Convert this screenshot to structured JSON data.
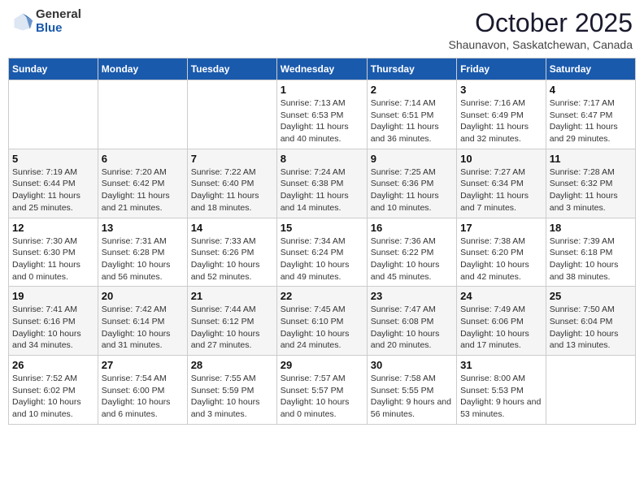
{
  "header": {
    "logo_general": "General",
    "logo_blue": "Blue",
    "month_title": "October 2025",
    "location": "Shaunavon, Saskatchewan, Canada"
  },
  "weekdays": [
    "Sunday",
    "Monday",
    "Tuesday",
    "Wednesday",
    "Thursday",
    "Friday",
    "Saturday"
  ],
  "weeks": [
    [
      {
        "day": "",
        "info": ""
      },
      {
        "day": "",
        "info": ""
      },
      {
        "day": "",
        "info": ""
      },
      {
        "day": "1",
        "info": "Sunrise: 7:13 AM\nSunset: 6:53 PM\nDaylight: 11 hours and 40 minutes."
      },
      {
        "day": "2",
        "info": "Sunrise: 7:14 AM\nSunset: 6:51 PM\nDaylight: 11 hours and 36 minutes."
      },
      {
        "day": "3",
        "info": "Sunrise: 7:16 AM\nSunset: 6:49 PM\nDaylight: 11 hours and 32 minutes."
      },
      {
        "day": "4",
        "info": "Sunrise: 7:17 AM\nSunset: 6:47 PM\nDaylight: 11 hours and 29 minutes."
      }
    ],
    [
      {
        "day": "5",
        "info": "Sunrise: 7:19 AM\nSunset: 6:44 PM\nDaylight: 11 hours and 25 minutes."
      },
      {
        "day": "6",
        "info": "Sunrise: 7:20 AM\nSunset: 6:42 PM\nDaylight: 11 hours and 21 minutes."
      },
      {
        "day": "7",
        "info": "Sunrise: 7:22 AM\nSunset: 6:40 PM\nDaylight: 11 hours and 18 minutes."
      },
      {
        "day": "8",
        "info": "Sunrise: 7:24 AM\nSunset: 6:38 PM\nDaylight: 11 hours and 14 minutes."
      },
      {
        "day": "9",
        "info": "Sunrise: 7:25 AM\nSunset: 6:36 PM\nDaylight: 11 hours and 10 minutes."
      },
      {
        "day": "10",
        "info": "Sunrise: 7:27 AM\nSunset: 6:34 PM\nDaylight: 11 hours and 7 minutes."
      },
      {
        "day": "11",
        "info": "Sunrise: 7:28 AM\nSunset: 6:32 PM\nDaylight: 11 hours and 3 minutes."
      }
    ],
    [
      {
        "day": "12",
        "info": "Sunrise: 7:30 AM\nSunset: 6:30 PM\nDaylight: 11 hours and 0 minutes."
      },
      {
        "day": "13",
        "info": "Sunrise: 7:31 AM\nSunset: 6:28 PM\nDaylight: 10 hours and 56 minutes."
      },
      {
        "day": "14",
        "info": "Sunrise: 7:33 AM\nSunset: 6:26 PM\nDaylight: 10 hours and 52 minutes."
      },
      {
        "day": "15",
        "info": "Sunrise: 7:34 AM\nSunset: 6:24 PM\nDaylight: 10 hours and 49 minutes."
      },
      {
        "day": "16",
        "info": "Sunrise: 7:36 AM\nSunset: 6:22 PM\nDaylight: 10 hours and 45 minutes."
      },
      {
        "day": "17",
        "info": "Sunrise: 7:38 AM\nSunset: 6:20 PM\nDaylight: 10 hours and 42 minutes."
      },
      {
        "day": "18",
        "info": "Sunrise: 7:39 AM\nSunset: 6:18 PM\nDaylight: 10 hours and 38 minutes."
      }
    ],
    [
      {
        "day": "19",
        "info": "Sunrise: 7:41 AM\nSunset: 6:16 PM\nDaylight: 10 hours and 34 minutes."
      },
      {
        "day": "20",
        "info": "Sunrise: 7:42 AM\nSunset: 6:14 PM\nDaylight: 10 hours and 31 minutes."
      },
      {
        "day": "21",
        "info": "Sunrise: 7:44 AM\nSunset: 6:12 PM\nDaylight: 10 hours and 27 minutes."
      },
      {
        "day": "22",
        "info": "Sunrise: 7:45 AM\nSunset: 6:10 PM\nDaylight: 10 hours and 24 minutes."
      },
      {
        "day": "23",
        "info": "Sunrise: 7:47 AM\nSunset: 6:08 PM\nDaylight: 10 hours and 20 minutes."
      },
      {
        "day": "24",
        "info": "Sunrise: 7:49 AM\nSunset: 6:06 PM\nDaylight: 10 hours and 17 minutes."
      },
      {
        "day": "25",
        "info": "Sunrise: 7:50 AM\nSunset: 6:04 PM\nDaylight: 10 hours and 13 minutes."
      }
    ],
    [
      {
        "day": "26",
        "info": "Sunrise: 7:52 AM\nSunset: 6:02 PM\nDaylight: 10 hours and 10 minutes."
      },
      {
        "day": "27",
        "info": "Sunrise: 7:54 AM\nSunset: 6:00 PM\nDaylight: 10 hours and 6 minutes."
      },
      {
        "day": "28",
        "info": "Sunrise: 7:55 AM\nSunset: 5:59 PM\nDaylight: 10 hours and 3 minutes."
      },
      {
        "day": "29",
        "info": "Sunrise: 7:57 AM\nSunset: 5:57 PM\nDaylight: 10 hours and 0 minutes."
      },
      {
        "day": "30",
        "info": "Sunrise: 7:58 AM\nSunset: 5:55 PM\nDaylight: 9 hours and 56 minutes."
      },
      {
        "day": "31",
        "info": "Sunrise: 8:00 AM\nSunset: 5:53 PM\nDaylight: 9 hours and 53 minutes."
      },
      {
        "day": "",
        "info": ""
      }
    ]
  ]
}
